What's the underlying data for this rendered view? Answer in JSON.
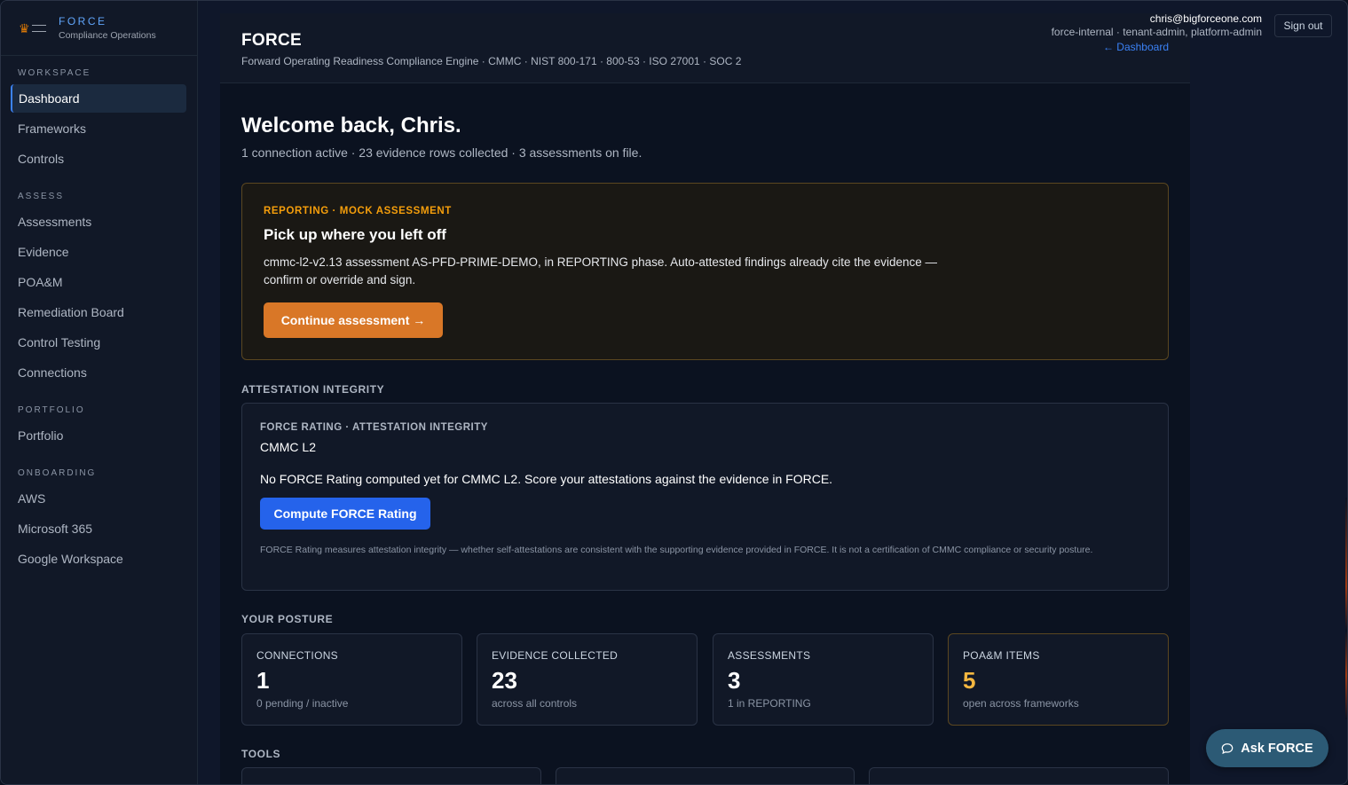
{
  "brand": {
    "name": "FORCE",
    "subtitle": "Compliance Operations"
  },
  "sidebar": {
    "sections": [
      {
        "title": "WORKSPACE",
        "items": [
          "Dashboard",
          "Frameworks",
          "Controls"
        ]
      },
      {
        "title": "ASSESS",
        "items": [
          "Assessments",
          "Evidence",
          "POA&M",
          "Remediation Board",
          "Control Testing",
          "Connections"
        ]
      },
      {
        "title": "PORTFOLIO",
        "items": [
          "Portfolio"
        ]
      },
      {
        "title": "ONBOARDING",
        "items": [
          "AWS",
          "Microsoft 365",
          "Google Workspace"
        ]
      }
    ],
    "active": "Dashboard"
  },
  "header": {
    "title": "FORCE",
    "subtitle": "Forward Operating Readiness Compliance Engine · CMMC · NIST 800-171 · 800-53 · ISO 27001 · SOC 2",
    "user_email": "chris@bigforceone.com",
    "user_roles": "force-internal · tenant-admin, platform-admin",
    "back_link": "← Dashboard",
    "signout_label": "Sign out"
  },
  "welcome": {
    "title": "Welcome back, Chris.",
    "summary": "1 connection active · 23 evidence rows collected · 3 assessments on file."
  },
  "resume": {
    "eyebrow": "REPORTING · MOCK ASSESSMENT",
    "title": "Pick up where you left off",
    "body": "cmmc-l2-v2.13 assessment AS-PFD-PRIME-DEMO, in REPORTING phase. Auto-attested findings already cite the evidence — confirm or override and sign.",
    "button_label": "Continue assessment →"
  },
  "attestation": {
    "section_title": "ATTESTATION INTEGRITY",
    "eyebrow": "FORCE RATING · ATTESTATION INTEGRITY",
    "framework": "CMMC L2",
    "message": "No FORCE Rating computed yet for CMMC L2. Score your attestations against the evidence in FORCE.",
    "button_label": "Compute FORCE Rating",
    "note": "FORCE Rating measures attestation integrity — whether self-attestations are consistent with the supporting evidence provided in FORCE. It is not a certification of CMMC compliance or security posture."
  },
  "posture": {
    "section_title": "YOUR POSTURE",
    "stats": [
      {
        "label": "CONNECTIONS",
        "value": "1",
        "sub": "0 pending / inactive"
      },
      {
        "label": "EVIDENCE COLLECTED",
        "value": "23",
        "sub": "across all controls"
      },
      {
        "label": "ASSESSMENTS",
        "value": "3",
        "sub": "1 in REPORTING"
      },
      {
        "label": "POA&M ITEMS",
        "value": "5",
        "sub": "open across frameworks"
      }
    ]
  },
  "tools": {
    "section_title": "TOOLS"
  },
  "ask": {
    "label": "Ask FORCE"
  },
  "colors": {
    "accent_blue": "#2563eb",
    "accent_amber": "#d97727",
    "warning_text": "#f5b740"
  }
}
